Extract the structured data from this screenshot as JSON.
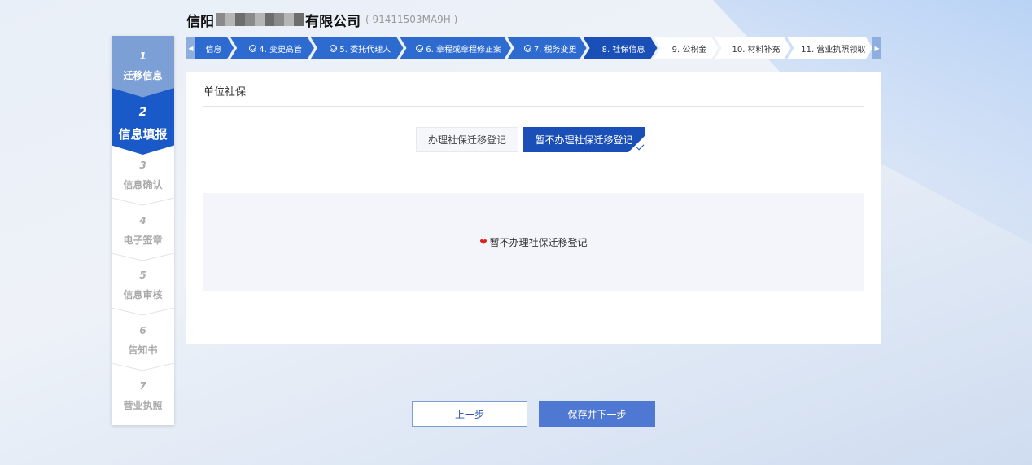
{
  "header": {
    "company_name_start": "信阳",
    "company_name_end": "有限公司",
    "credit_code": "( 91411503MA9H      )"
  },
  "sidebar": {
    "steps": [
      {
        "num": "1",
        "label": "迁移信息"
      },
      {
        "num": "2",
        "label": "信息填报"
      },
      {
        "num": "3",
        "label": "信息确认"
      },
      {
        "num": "4",
        "label": "电子签章"
      },
      {
        "num": "5",
        "label": "信息审核"
      },
      {
        "num": "6",
        "label": "告知书"
      },
      {
        "num": "7",
        "label": "营业执照"
      }
    ]
  },
  "tabs": {
    "items": [
      {
        "label": "信息"
      },
      {
        "label": "4. 变更高管"
      },
      {
        "label": "5. 委托代理人"
      },
      {
        "label": "6. 章程或章程修正案"
      },
      {
        "label": "7. 税务变更"
      },
      {
        "label": "8. 社保信息"
      },
      {
        "label": "9. 公积金"
      },
      {
        "label": "10. 材料补充"
      },
      {
        "label": "11. 营业执照领取"
      }
    ]
  },
  "panel": {
    "title": "单位社保",
    "option_register": "办理社保迁移登记",
    "option_not_register": "暂不办理社保迁移登记",
    "info_text": "暂不办理社保迁移登记"
  },
  "buttons": {
    "prev": "上一步",
    "next": "保存并下一步"
  },
  "colors": {
    "primary": "#1a4fb8",
    "tab_done": "#2e6bd0",
    "sidebar_done": "#7c9fd6",
    "heart": "#d9251d"
  }
}
